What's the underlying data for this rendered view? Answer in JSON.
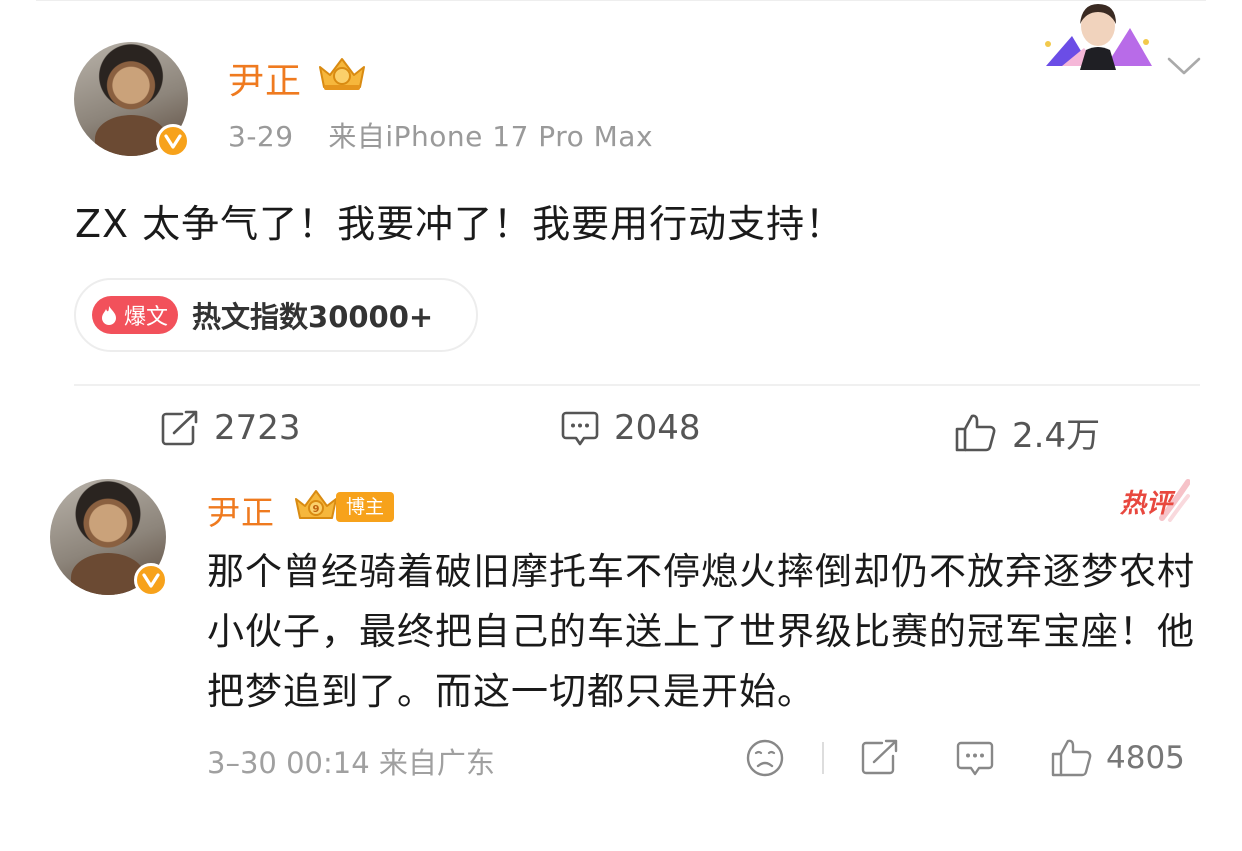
{
  "post": {
    "author": "尹正",
    "date": "3-29",
    "source": "来自iPhone 17 Pro Max",
    "text": "ZX 太争气了！我要冲了！我要用行动支持！",
    "hot_badge": "爆文",
    "hot_label": "热文指数30000+"
  },
  "actions": {
    "repost_count": "2723",
    "comment_count": "2048",
    "like_count": "2.4万"
  },
  "comment": {
    "author": "尹正",
    "crown_level": "9",
    "role_tag": "博主",
    "hot_tag": "热评",
    "text": "那个曾经骑着破旧摩托车不停熄火摔倒却仍不放弃逐梦农村小伙子，最终把自己的车送上了世界级比赛的冠军宝座！他把梦追到了。而这一切都只是开始。",
    "meta": "3–30 00:14 来自广东",
    "like_count": "4805"
  },
  "colors": {
    "accent_orange": "#ef7a1f",
    "badge_gold": "#f7a21b",
    "hot_red": "#f2515b"
  },
  "icons": [
    "verified-icon",
    "crown-badge-icon",
    "chevron-down-icon",
    "repost-icon",
    "comment-icon",
    "like-icon",
    "sad-face-icon",
    "share-icon",
    "reply-icon"
  ]
}
